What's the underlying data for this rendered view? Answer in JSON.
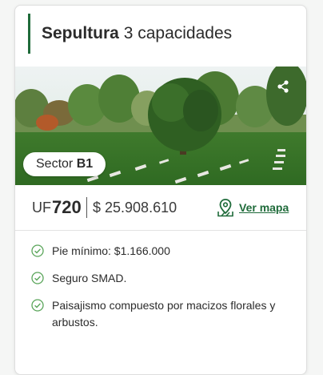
{
  "card": {
    "title_bold": "Sepultura",
    "title_rest": "3 capacidades",
    "sector_prefix": "Sector",
    "sector_value": "B1",
    "price": {
      "uf_label": "UF",
      "uf_value": "720",
      "clp_value": "$ 25.908.610"
    },
    "map_link_label": "Ver mapa",
    "features": [
      "Pie mínimo: $1.166.000",
      "Seguro SMAD.",
      "Paisajismo compuesto por macizos florales y arbustos."
    ]
  },
  "icons": {
    "share": "share-icon",
    "map": "map-pin-icon",
    "check": "check-circle-icon"
  },
  "colors": {
    "accent_green": "#1f6b3a",
    "check_green": "#5aa55a"
  }
}
